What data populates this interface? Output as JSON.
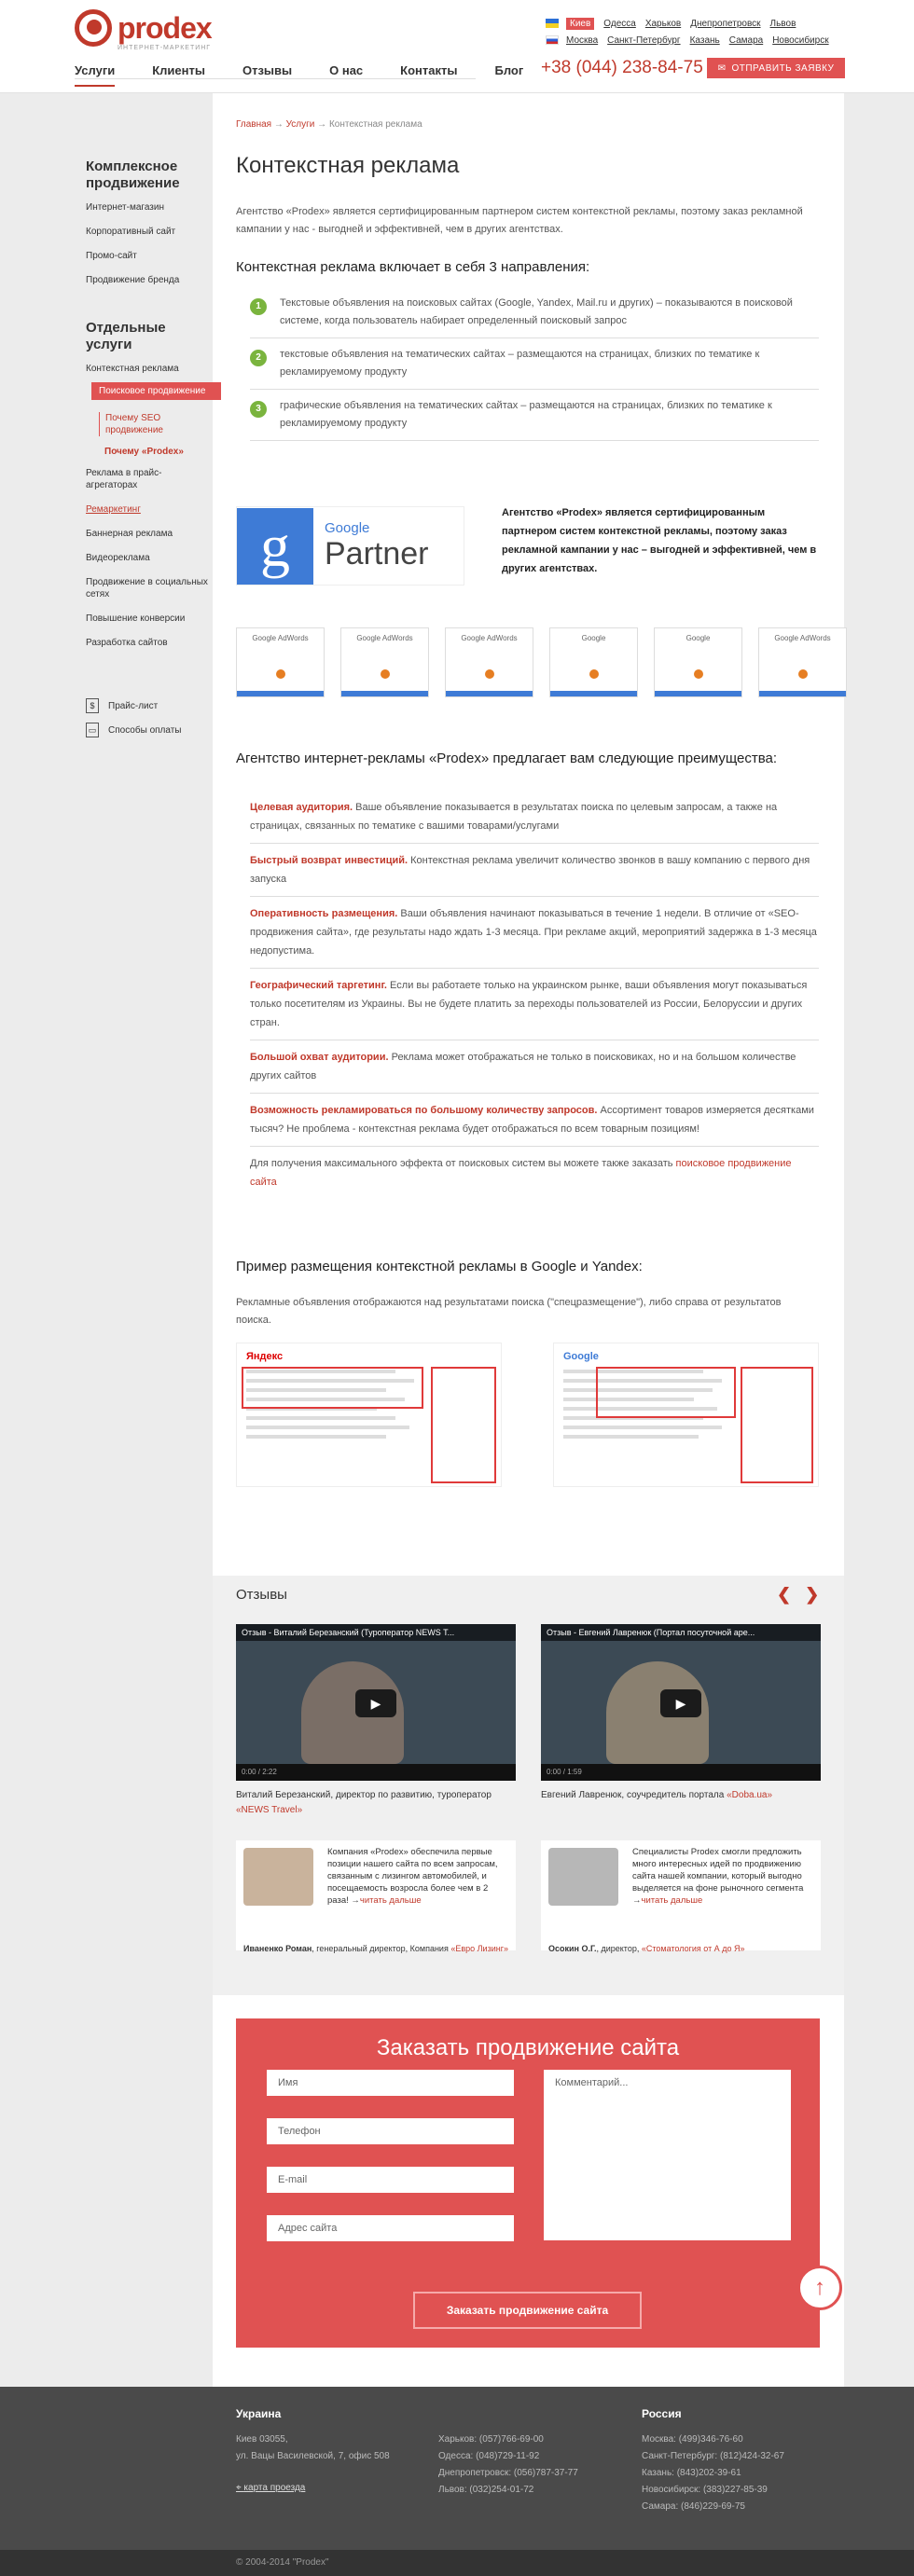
{
  "header": {
    "logo": "prodex",
    "logo_tag": "ИНТЕРНЕТ-МАРКЕТИНГ",
    "nav": [
      "Услуги",
      "Клиенты",
      "Отзывы",
      "О нас",
      "Контакты",
      "Блог"
    ],
    "cities_ua": [
      "Киев",
      "Одесса",
      "Харьков",
      "Днепропетровск",
      "Львов"
    ],
    "cities_ru": [
      "Москва",
      "Санкт-Петербург",
      "Казань",
      "Самара",
      "Новосибирск"
    ],
    "phone": "+38 (044) 238-84-75",
    "order_button": "ОТПРАВИТЬ ЗАЯВКУ"
  },
  "sidebar": {
    "heading1": "Комплексное продвижение",
    "items1": [
      "Интернет-магазин",
      "Корпоративный сайт",
      "Промо-сайт",
      "Продвижение бренда"
    ],
    "heading2": "Отдельные услуги",
    "ctx": "Контекстная реклама",
    "active": "Поисковое продвижение",
    "sub1": "Почему SEO продвижение",
    "sub2": "Почему «Prodex»",
    "items2a": [
      "Реклама в прайс-агрегаторах"
    ],
    "remarketing": "Ремаркетинг",
    "items2b": [
      "Баннерная реклама",
      "Видеореклама",
      "Продвижение в социальных сетях",
      "Повышение конверсии",
      "Разработка сайтов"
    ],
    "price": "Прайс-лист",
    "payment": "Способы оплаты"
  },
  "content": {
    "crumb_home": "Главная",
    "crumb_services": "Услуги",
    "crumb_current": "Контекстная реклама",
    "title": "Контекстная реклама",
    "intro": "Агентство «Prodex» является сертифицированным партнером систем контекстной рекламы, поэтому заказ рекламной кампании у нас - выгодней и эффективней, чем в других агентствах.",
    "dirs_title": "Контекстная реклама включает в себя 3 направления:",
    "dirs": [
      "Текстовые объявления на поисковых сайтах (Google, Yandex, Mail.ru и других) – показываются в поисковой системе, когда пользователь набирает определенный поисковый запрос",
      "текстовые объявления на тематических сайтах – размещаются на страницах, близких по тематике к рекламируемому продукту",
      "графические объявления на тематических сайтах – размещаются на страницах, близких по тематике к рекламируемому продукту"
    ],
    "partner_google": "Google",
    "partner_word": "Partner",
    "partner_text": "Агентство «Prodex» является сертифицированным партнером систем контекстной рекламы, поэтому заказ рекламной кампании у нас – выгодней и эффективней, чем в других агентствах.",
    "certs": [
      "Google AdWords",
      "Google AdWords",
      "Google AdWords",
      "Google",
      "Google",
      "Google AdWords"
    ],
    "adv_title": "Агентство интернет-рекламы «Prodex» предлагает вам следующие преимущества:",
    "adv": [
      {
        "b": "Целевая аудитория.",
        "t": " Ваше объявление показывается в результатах поиска по целевым запросам, а также на страницах, связанных по тематике с вашими товарами/услугами"
      },
      {
        "b": "Быстрый возврат инвестиций.",
        "t": " Контекстная реклама увеличит количество звонков в вашу компанию с первого дня запуска"
      },
      {
        "b": "Оперативность размещения.",
        "t": " Ваши объявления начинают показываться в течение 1 недели. В отличие от «SEO-продвижения сайта», где результаты надо ждать 1-3 месяца. При рекламе акций, мероприятий задержка в 1-3 месяца недопустима."
      },
      {
        "b": "Географический таргетинг.",
        "t": " Если вы работаете только на украинском рынке, ваши объявления могут показываться только посетителям из Украины. Вы не будете платить за переходы пользователей из России, Белоруссии и других стран."
      },
      {
        "b": "Большой охват аудитории.",
        "t": " Реклама может отображаться не только в поисковиках, но и на большом количестве других сайтов"
      },
      {
        "b": "Возможность рекламироваться по большому количеству запросов.",
        "t": " Ассортимент товаров измеряется десятками тысяч? Не проблема - контекстная реклама будет отображаться по всем товарным позициям!"
      }
    ],
    "adv_final": "Для получения максимального эффекта от поисковых систем вы можете также заказать",
    "adv_final_link": "поисковое продвижение сайта",
    "example_title": "Пример размещения контекстной рекламы в Google и Yandex:",
    "example_text": "Рекламные объявления отображаются над результатами поиска (\"спецразмещение\"), либо справа от результатов поиска.",
    "serp_yandex": "Яндекс",
    "serp_google": "Google"
  },
  "reviews": {
    "title": "Отзывы",
    "video1_title": "Отзыв - Виталий Березанский (Туроператор NEWS T...",
    "video2_title": "Отзыв - Евгений Лавренюк (Портал посуточной аре...",
    "video1_time": "0:00 / 2:22",
    "video2_time": "0:00 / 1:59",
    "video1_cap": "Виталий Березанский, директор по развитию, туроператор",
    "video1_link": "«NEWS Travel»",
    "video2_cap": "Евгений Лавренюк, соучредитель портала",
    "video2_link": "«Doba.ua»",
    "t1_text": "Компания «Prodex» обеспечила первые позиции нашего сайта по всем запросам, связанным с лизингом автомобилей, и посещаемость возросла более чем в 2 раза!",
    "t1_link": "читать дальше",
    "t2_text": "Специалисты Prodex смогли предложить много интересных идей по продвижению сайта нашей компании, который выгодно выделяется на фоне рыночного сегмента",
    "t2_link": "читать дальше",
    "t1_author": "Иваненко Роман",
    "t1_role": ", генеральный директор, Компания",
    "t1_company": "«Евро Лизинг»",
    "t2_author": "Осокин О.Г.",
    "t2_role": ", директор,",
    "t2_company": "«Стоматология от А до Я»"
  },
  "form": {
    "title": "Заказать продвижение сайта",
    "name": "Имя",
    "phone": "Телефон",
    "email": "E-mail",
    "address": "Адрес сайта",
    "comment": "Комментарий...",
    "submit": "Заказать продвижение сайта"
  },
  "footer": {
    "ua_title": "Украина",
    "ua_address": [
      "Киев 03055,",
      "ул. Вацы Василевской, 7, офис 508"
    ],
    "map": "карта проезда",
    "ua_phones": [
      "Харьков: (057)766-69-00",
      "Одесса: (048)729-11-92",
      "Днепропетровск: (056)787-37-77",
      "Львов: (032)254-01-72"
    ],
    "ru_title": "Россия",
    "ru_phones": [
      "Москва: (499)346-76-60",
      "Санкт-Петербург: (812)424-32-67",
      "Казань: (843)202-39-61",
      "Новосибирск: (383)227-85-39",
      "Самара: (846)229-69-75"
    ],
    "copyright": "© 2004-2014 \"Prodex\""
  }
}
